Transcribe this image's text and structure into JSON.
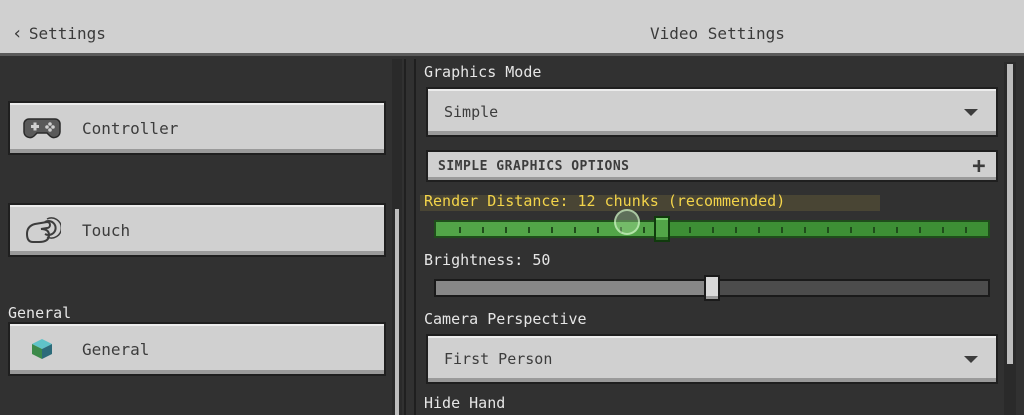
{
  "header": {
    "back_label": "Settings",
    "title": "Video Settings"
  },
  "sidebar": {
    "items": [
      {
        "label": "Controller",
        "icon": "gamepad-icon"
      },
      {
        "label": "Touch",
        "icon": "touch-hand-icon"
      }
    ],
    "section_label": "General",
    "general_item": {
      "label": "General",
      "icon": "cube-icon"
    }
  },
  "settings": {
    "graphics_mode": {
      "label": "Graphics Mode",
      "value": "Simple"
    },
    "section_header": "SIMPLE GRAPHICS OPTIONS",
    "render_distance": {
      "label": "Render Distance: 12 chunks (recommended)",
      "fraction": 0.41
    },
    "brightness": {
      "label": "Brightness: 50",
      "fraction": 0.5
    },
    "camera_perspective": {
      "label": "Camera Perspective",
      "value": "First Person"
    },
    "hide_hand": {
      "label": "Hide Hand"
    }
  },
  "colors": {
    "panel": "#313131",
    "button": "#d0d0d0",
    "slider_green": "#52a548",
    "highlight_text": "#f3d44a"
  }
}
